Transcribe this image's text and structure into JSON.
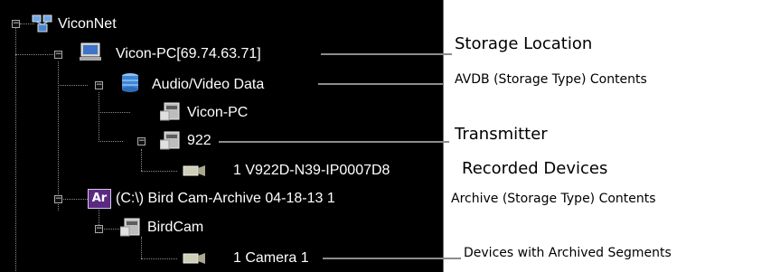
{
  "tree": {
    "nodes": [
      {
        "label": "ViconNet"
      },
      {
        "label": "Vicon-PC[69.74.63.71]"
      },
      {
        "label": "Audio/Video Data"
      },
      {
        "label": "Vicon-PC"
      },
      {
        "label": "922"
      },
      {
        "label": "1  V922D-N39-IP0007D8"
      },
      {
        "label": "(C:\\) Bird Cam-Archive 04-18-13 1"
      },
      {
        "label": "BirdCam"
      },
      {
        "label": "1  Camera 1"
      }
    ],
    "archive_badge": "Ar",
    "expander_symbol": "−"
  },
  "annotations": [
    {
      "text": "Storage Location"
    },
    {
      "text": "AVDB (Storage Type) Contents"
    },
    {
      "text": "Transmitter"
    },
    {
      "text": "Recorded Devices"
    },
    {
      "text": "Archive (Storage Type) Contents"
    },
    {
      "text": "Devices with Archived Segments"
    }
  ],
  "colors": {
    "tree_bg": "#000000",
    "tree_text": "#ffffff",
    "leader": "#8c8c8c",
    "archive_badge": "#5a2a82"
  }
}
